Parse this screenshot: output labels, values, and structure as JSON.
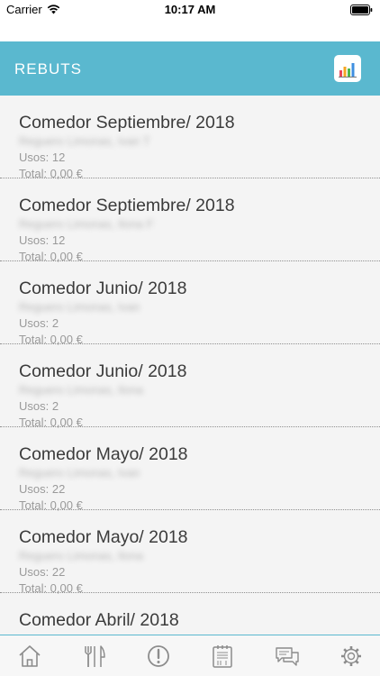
{
  "status_bar": {
    "carrier": "Carrier",
    "time": "10:17 AM"
  },
  "header": {
    "title": "REBUTS",
    "action_icon": "bar-chart-icon"
  },
  "receipts": [
    {
      "title": "Comedor Septiembre/ 2018",
      "person": "Reguero Limonas, Ivan T",
      "uses": "Usos: 12",
      "total": "Total: 0,00 €"
    },
    {
      "title": "Comedor Septiembre/ 2018",
      "person": "Reguero Limonas, Ilona F",
      "uses": "Usos: 12",
      "total": "Total: 0,00 €"
    },
    {
      "title": "Comedor Junio/ 2018",
      "person": "Reguero Limonas, Ivan",
      "uses": "Usos: 2",
      "total": "Total: 0,00 €"
    },
    {
      "title": "Comedor Junio/ 2018",
      "person": "Reguero Limonas, Ilona",
      "uses": "Usos: 2",
      "total": "Total: 0,00 €"
    },
    {
      "title": "Comedor Mayo/ 2018",
      "person": "Reguero Limonas, Ivan",
      "uses": "Usos: 22",
      "total": "Total: 0,00 €"
    },
    {
      "title": "Comedor Mayo/ 2018",
      "person": "Reguero Limonas, Ilona",
      "uses": "Usos: 22",
      "total": "Total: 0,00 €"
    },
    {
      "title": "Comedor Abril/ 2018",
      "person": "",
      "uses": "",
      "total": ""
    }
  ],
  "tabbar": {
    "icons": [
      "home-icon",
      "cutlery-icon",
      "alert-icon",
      "menu-calendar-icon",
      "messages-icon",
      "settings-icon"
    ],
    "colors": {
      "icon": "#8c8c8c",
      "accent": "#5ab8cf"
    }
  }
}
